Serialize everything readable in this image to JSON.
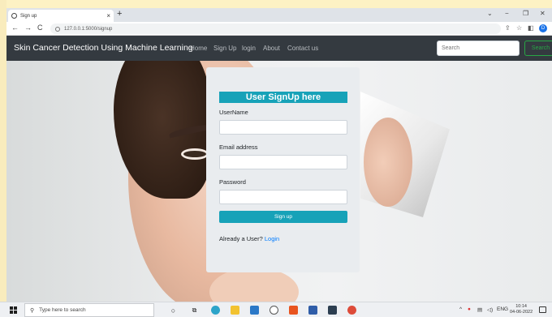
{
  "browser": {
    "tab_title": "Sign up",
    "tab_close": "×",
    "new_tab": "+",
    "url": "127.0.0.1:5000/signup",
    "profile_initial": "D",
    "window_controls": [
      "⌄",
      "−",
      "❐",
      "✕"
    ],
    "nav_icons": [
      "←",
      "→",
      "C"
    ],
    "toolbar_icons": [
      "⇪",
      "☆",
      "◧",
      "⋮"
    ]
  },
  "navbar": {
    "brand": "Skin Cancer Detection Using Machine Learning",
    "links": [
      "Home",
      "Sign Up",
      "login",
      "About",
      "Contact us"
    ],
    "search_placeholder": "Search",
    "search_button": "Search"
  },
  "signup": {
    "title": "User SignUp here",
    "username_label": "UserName",
    "email_label": "Email address",
    "password_label": "Password",
    "submit_label": "Sign up",
    "already_text": "Already a User?",
    "login_link": "Login"
  },
  "taskbar": {
    "search_placeholder": "Type here to search",
    "language": "ENG",
    "time": "10:14",
    "date": "04-06-2022"
  },
  "colors": {
    "navbar_bg": "#343a40",
    "accent": "#17a2b8",
    "link": "#007bff",
    "search_button": "#28a745"
  }
}
